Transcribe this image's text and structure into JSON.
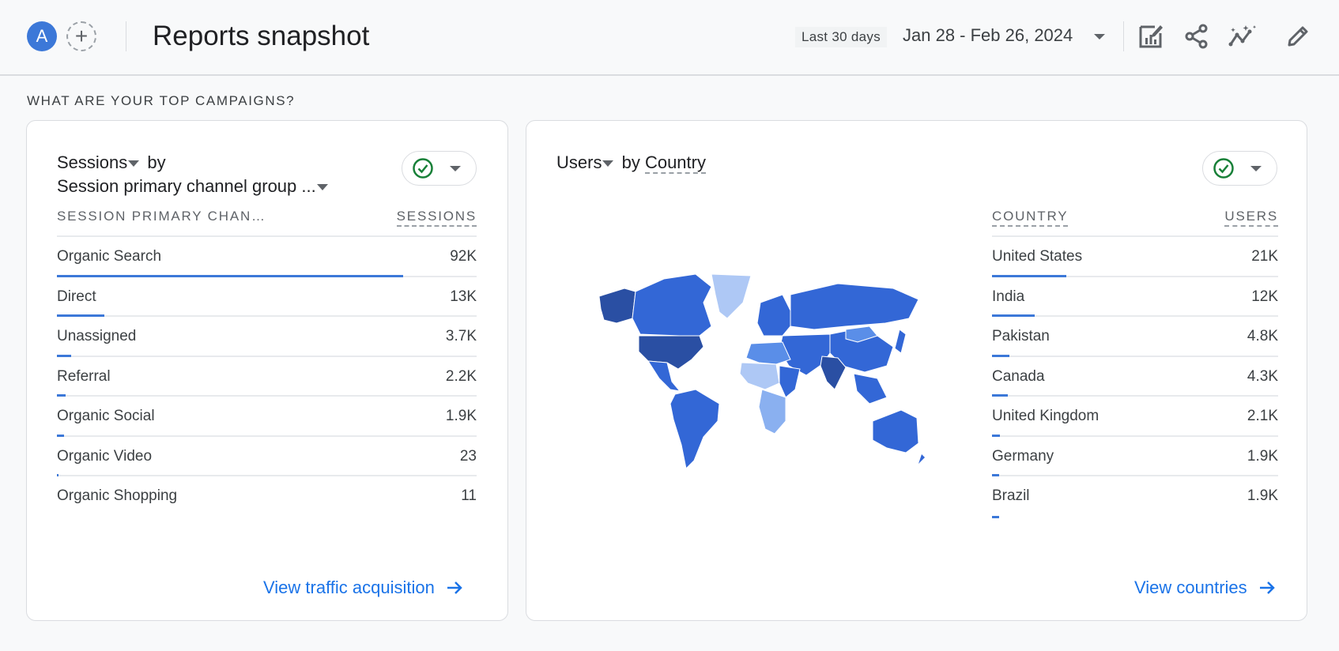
{
  "header": {
    "avatar_letter": "A",
    "add_comparison_symbol": "+",
    "title": "Reports snapshot",
    "date_preset": "Last 30 days",
    "date_range": "Jan 28 - Feb 26, 2024",
    "icons": [
      "customize-report-icon",
      "share-icon",
      "insights-icon",
      "edit-icon"
    ]
  },
  "section": {
    "heading": "WHAT ARE YOUR TOP CAMPAIGNS?"
  },
  "sessions_card": {
    "metric": "Sessions",
    "by": "by",
    "dimension": "Session primary channel group ...",
    "col_dimension": "SESSION PRIMARY CHAN…",
    "col_metric": "SESSIONS",
    "rows": [
      {
        "label": "Organic Search",
        "value": "92K",
        "share": 1.0
      },
      {
        "label": "Direct",
        "value": "13K",
        "share": 0.137
      },
      {
        "label": "Unassigned",
        "value": "3.7K",
        "share": 0.04
      },
      {
        "label": "Referral",
        "value": "2.2K",
        "share": 0.024
      },
      {
        "label": "Organic Social",
        "value": "1.9K",
        "share": 0.021
      },
      {
        "label": "Organic Video",
        "value": "23",
        "share": 0.003
      },
      {
        "label": "Organic Shopping",
        "value": "11",
        "share": 0.0
      }
    ],
    "link": "View traffic acquisition"
  },
  "users_card": {
    "metric": "Users",
    "by": "by",
    "dimension": "Country",
    "col_dimension": "COUNTRY",
    "col_metric": "USERS",
    "rows": [
      {
        "label": "United States",
        "value": "21K",
        "share": 0.26
      },
      {
        "label": "India",
        "value": "12K",
        "share": 0.148
      },
      {
        "label": "Pakistan",
        "value": "4.8K",
        "share": 0.06
      },
      {
        "label": "Canada",
        "value": "4.3K",
        "share": 0.055
      },
      {
        "label": "United Kingdom",
        "value": "2.1K",
        "share": 0.027
      },
      {
        "label": "Germany",
        "value": "1.9K",
        "share": 0.024
      },
      {
        "label": "Brazil",
        "value": "1.9K",
        "share": 0.024
      }
    ],
    "link": "View countries"
  },
  "colors": {
    "accent": "#3c78d8",
    "link": "#1a73e8",
    "check": "#188038",
    "map_dark": "#2a4fa3",
    "map_mid": "#3367d6",
    "map_light": "#5a8ee8",
    "map_pale": "#aec8f5"
  }
}
